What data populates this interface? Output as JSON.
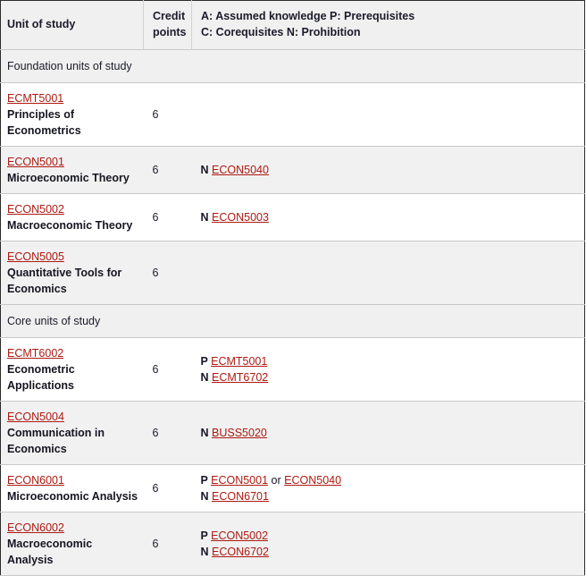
{
  "table": {
    "header": {
      "unit_label": "Unit of study",
      "credit_label_line1": "Credit",
      "credit_label_line2": "points",
      "req_label_line1": "A: Assumed knowledge P: Prerequisites",
      "req_label_line2": "C: Corequisites N: Prohibition"
    },
    "sections": [
      {
        "title": "Foundation units of study",
        "rows": [
          {
            "code": "ECMT5001",
            "title": "Principles of Econometrics",
            "credit": "6",
            "requirements": []
          },
          {
            "code": "ECON5001",
            "title": "Microeconomic Theory",
            "credit": "6",
            "requirements": [
              {
                "prefix": "N",
                "links": [
                  "ECON5040"
                ],
                "joiner": ""
              }
            ]
          },
          {
            "code": "ECON5002",
            "title": "Macroeconomic Theory",
            "credit": "6",
            "requirements": [
              {
                "prefix": "N",
                "links": [
                  "ECON5003"
                ],
                "joiner": ""
              }
            ]
          },
          {
            "code": "ECON5005",
            "title": "Quantitative Tools for Economics",
            "credit": "6",
            "requirements": []
          }
        ]
      },
      {
        "title": "Core units of study",
        "rows": [
          {
            "code": "ECMT6002",
            "title": "Econometric Applications",
            "credit": "6",
            "requirements": [
              {
                "prefix": "P",
                "links": [
                  "ECMT5001"
                ],
                "joiner": ""
              },
              {
                "prefix": "N",
                "links": [
                  "ECMT6702"
                ],
                "joiner": ""
              }
            ]
          },
          {
            "code": "ECON5004",
            "title": "Communication in Economics",
            "credit": "6",
            "requirements": [
              {
                "prefix": "N",
                "links": [
                  "BUSS5020"
                ],
                "joiner": ""
              }
            ]
          },
          {
            "code": "ECON6001",
            "title": "Microeconomic Analysis",
            "credit": "6",
            "requirements": [
              {
                "prefix": "P",
                "links": [
                  "ECON5001",
                  "ECON5040"
                ],
                "joiner": "or"
              },
              {
                "prefix": "N",
                "links": [
                  "ECON6701"
                ],
                "joiner": ""
              }
            ]
          },
          {
            "code": "ECON6002",
            "title": "Macroeconomic Analysis",
            "credit": "6",
            "requirements": [
              {
                "prefix": "P",
                "links": [
                  "ECON5002"
                ],
                "joiner": ""
              },
              {
                "prefix": "N",
                "links": [
                  "ECON6702"
                ],
                "joiner": ""
              }
            ]
          }
        ]
      }
    ]
  },
  "colors": {
    "link": "#ac1a12",
    "text": "#161622",
    "stripe": "#f1f1f1",
    "section_bg": "#f0f0f0",
    "border": "#c8c8c8"
  }
}
